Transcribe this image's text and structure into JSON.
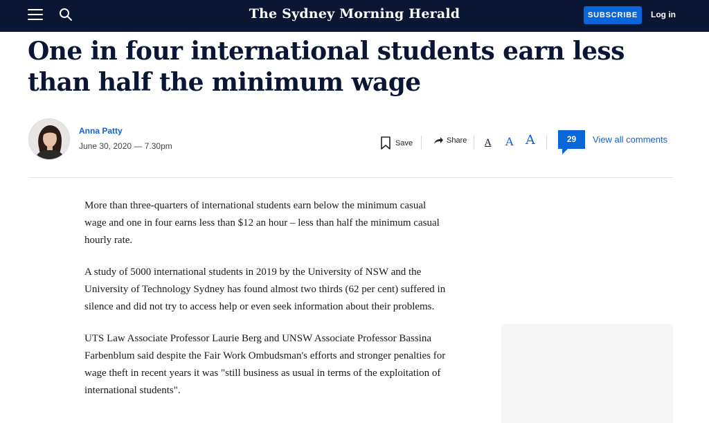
{
  "header": {
    "masthead": "The Sydney Morning Herald",
    "subscribe_label": "SUBSCRIBE",
    "login_label": "Log in",
    "menu_icon": "hamburger-menu-icon",
    "search_icon": "search-icon"
  },
  "article": {
    "headline": "One in four international students earn less than half the minimum wage",
    "author": "Anna Patty",
    "date": "June 30, 2020 — 7.30pm",
    "paragraphs": [
      "More than three-quarters of international students earn below the minimum casual wage and one in four earns less than $12 an hour – less than half the minimum casual hourly rate.",
      "A study of 5000 international students in 2019 by the University of NSW and the University of Technology Sydney has found almost two thirds (62 per cent) suffered in silence and did not try to access help or even seek information about their problems.",
      "UTS Law Associate Professor Laurie Berg and UNSW Associate Professor Bassina Farbenblum said despite the Fair Work Ombudsman's efforts and stronger penalties for wage theft in recent years it was \"still business as usual in terms of the exploitation of international students\"."
    ]
  },
  "toolbar": {
    "save_label": "Save",
    "share_label": "Share",
    "font_small": "A",
    "font_medium": "A",
    "font_large": "A",
    "comment_count": "29",
    "view_comments_label": "View all comments"
  },
  "colors": {
    "navy": "#0a1633",
    "accent_blue": "#0a66d8"
  }
}
